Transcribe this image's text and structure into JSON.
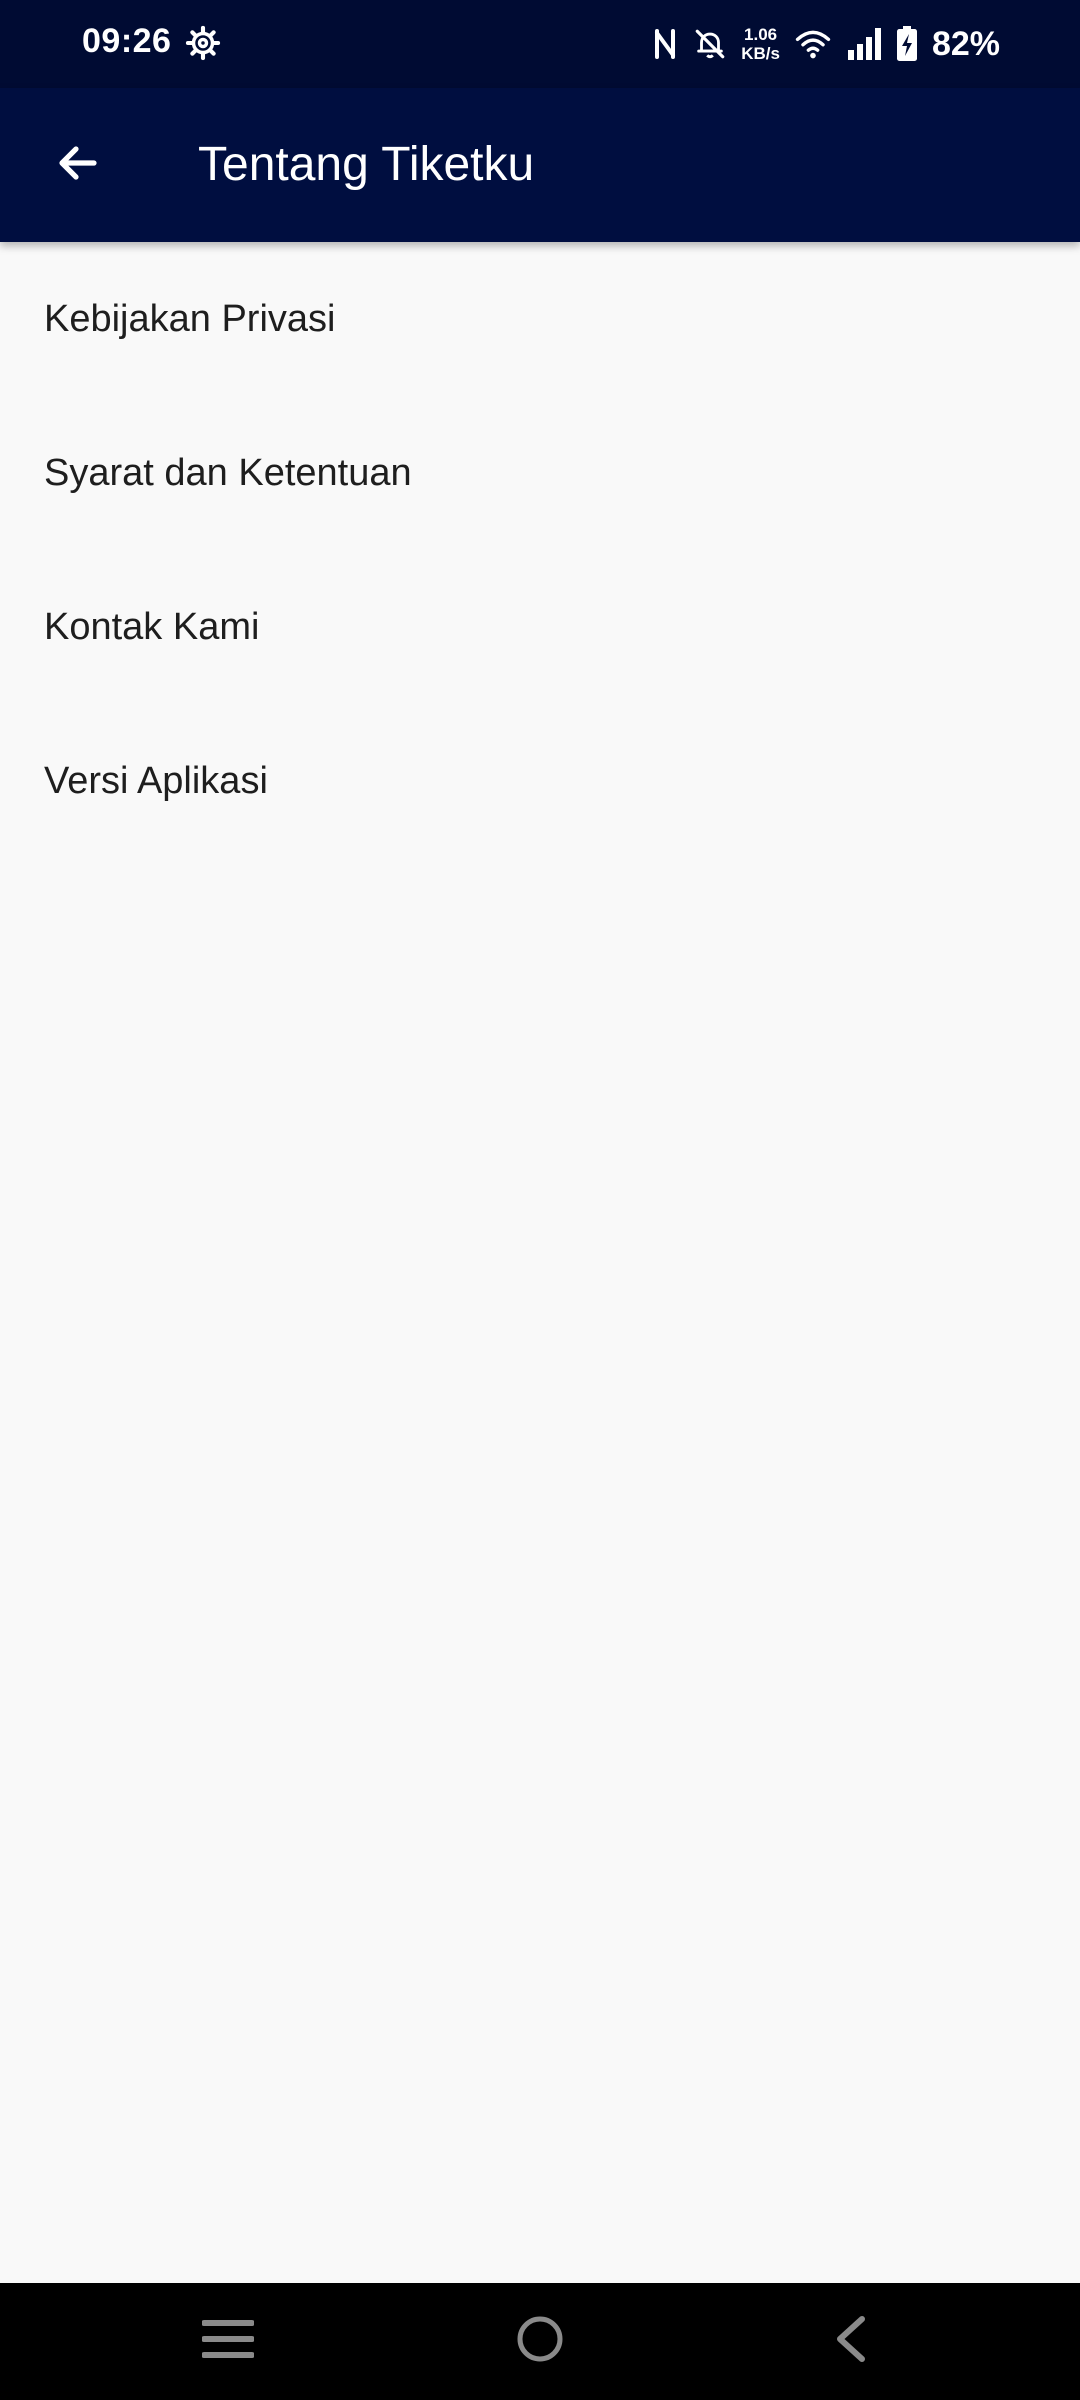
{
  "status_bar": {
    "time": "09:26",
    "net_speed_value": "1.06",
    "net_speed_unit": "KB/s",
    "battery": "82%",
    "icons": [
      "gear-icon",
      "nfc-icon",
      "bell-off-icon",
      "wifi-icon",
      "signal-icon",
      "battery-charging-icon"
    ]
  },
  "app_bar": {
    "title": "Tentang Tiketku",
    "back_icon": "arrow-left-icon"
  },
  "menu": {
    "items": [
      {
        "label": "Kebijakan Privasi"
      },
      {
        "label": "Syarat dan Ketentuan"
      },
      {
        "label": "Kontak Kami"
      },
      {
        "label": "Versi Aplikasi"
      }
    ]
  },
  "nav_bar": {
    "icons": [
      "recents-icon",
      "home-icon",
      "back-icon"
    ]
  },
  "colors": {
    "status_bar": "#000b33",
    "app_bar": "#000e40",
    "background": "#f9f9f9",
    "text": "#1e1e1e"
  }
}
